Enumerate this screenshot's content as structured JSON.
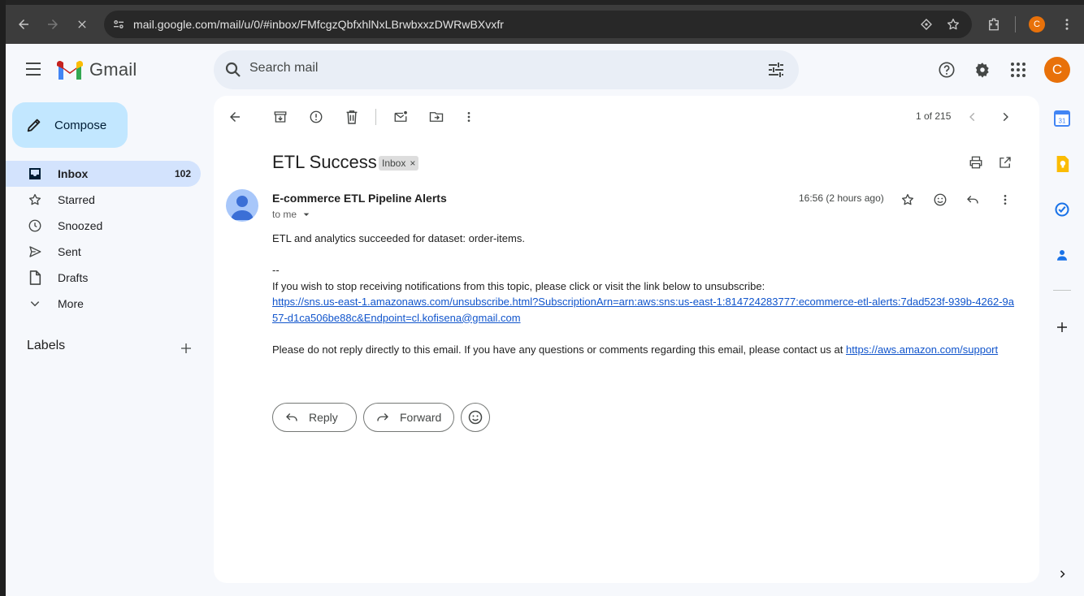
{
  "browser": {
    "url": "mail.google.com/mail/u/0/#inbox/FMfcgzQbfxhlNxLBrwbxxzDWRwBXvxfr",
    "profile_letter": "C"
  },
  "header": {
    "app_name": "Gmail",
    "search_placeholder": "Search mail",
    "account_letter": "C"
  },
  "sidebar": {
    "compose_label": "Compose",
    "items": [
      {
        "label": "Inbox",
        "count": "102"
      },
      {
        "label": "Starred",
        "count": ""
      },
      {
        "label": "Snoozed",
        "count": ""
      },
      {
        "label": "Sent",
        "count": ""
      },
      {
        "label": "Drafts",
        "count": ""
      },
      {
        "label": "More",
        "count": ""
      }
    ],
    "labels_title": "Labels"
  },
  "toolbar": {
    "pager": "1 of 215"
  },
  "message": {
    "subject": "ETL Success",
    "label_chip": "Inbox",
    "sender": "E-commerce ETL Pipeline Alerts",
    "recipient": "to me",
    "time": "16:56 (2 hours ago)",
    "body_line1": "ETL and analytics succeeded for dataset: order-items.",
    "signature_sep": "--",
    "unsubscribe_text": "If you wish to stop receiving notifications from this topic, please click or visit the link below to unsubscribe:",
    "unsubscribe_link": "https://sns.us-east-1.amazonaws.com/unsubscribe.html?SubscriptionArn=arn:aws:sns:us-east-1:814724283777:ecommerce-etl-alerts:7dad523f-939b-4262-9a57-d1ca506be88c&Endpoint=cl.kofisena@gmail.com",
    "noreply_text": "Please do not reply directly to this email. If you have any questions or comments regarding this email, please contact us at ",
    "support_link": "https://aws.amazon.com/support"
  },
  "actions": {
    "reply_label": "Reply",
    "forward_label": "Forward"
  },
  "side_panel": {
    "calendar_day": "31"
  }
}
